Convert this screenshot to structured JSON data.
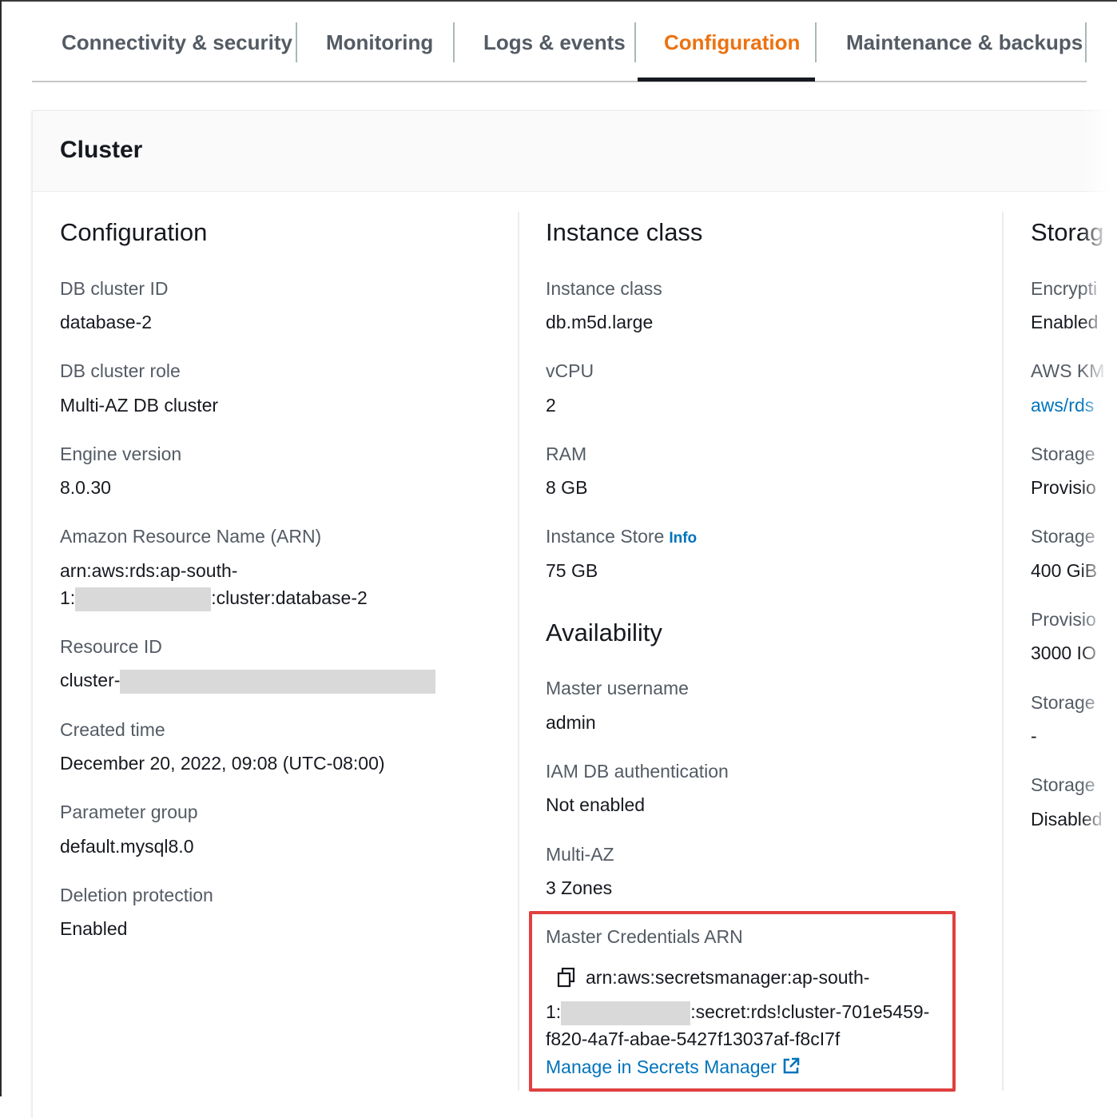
{
  "tabs": {
    "items": [
      {
        "label": "Connectivity & security",
        "active": false
      },
      {
        "label": "Monitoring",
        "active": false
      },
      {
        "label": "Logs & events",
        "active": false
      },
      {
        "label": "Configuration",
        "active": true
      },
      {
        "label": "Maintenance & backups",
        "active": false
      }
    ]
  },
  "panel": {
    "title": "Cluster"
  },
  "configuration": {
    "title": "Configuration",
    "db_cluster_id": {
      "label": "DB cluster ID",
      "value": "database-2"
    },
    "db_cluster_role": {
      "label": "DB cluster role",
      "value": "Multi-AZ DB cluster"
    },
    "engine_version": {
      "label": "Engine version",
      "value": "8.0.30"
    },
    "arn": {
      "label": "Amazon Resource Name (ARN)",
      "line1": "arn:aws:rds:ap-south-",
      "line2_prefix": "1:",
      "line2_suffix": ":cluster:database-2"
    },
    "resource_id": {
      "label": "Resource ID",
      "value_prefix": "cluster-"
    },
    "created_time": {
      "label": "Created time",
      "value": "December 20, 2022, 09:08 (UTC-08:00)"
    },
    "parameter_group": {
      "label": "Parameter group",
      "value": "default.mysql8.0"
    },
    "deletion_protection": {
      "label": "Deletion protection",
      "value": "Enabled"
    }
  },
  "instance_class": {
    "title": "Instance class",
    "instance_class": {
      "label": "Instance class",
      "value": "db.m5d.large"
    },
    "vcpu": {
      "label": "vCPU",
      "value": "2"
    },
    "ram": {
      "label": "RAM",
      "value": "8 GB"
    },
    "instance_store": {
      "label": "Instance Store",
      "info": "Info",
      "value": "75 GB"
    }
  },
  "availability": {
    "title": "Availability",
    "master_username": {
      "label": "Master username",
      "value": "admin"
    },
    "iam_db_auth": {
      "label": "IAM DB authentication",
      "value": "Not enabled"
    },
    "multi_az": {
      "label": "Multi-AZ",
      "value": "3 Zones"
    },
    "master_credentials": {
      "label": "Master Credentials ARN",
      "line1": "arn:aws:secretsmanager:ap-south-",
      "line2_prefix": "1:",
      "line2_suffix": ":secret:rds!cluster-701e5459-",
      "line3": "f820-4a7f-abae-5427f13037af-f8cI7f",
      "link": "Manage in Secrets Manager"
    }
  },
  "storage": {
    "title": "Storag",
    "rows": [
      {
        "label": "Encrypti",
        "value": "Enabled"
      },
      {
        "label": "AWS KM",
        "value": "aws/rds",
        "is_link": true
      },
      {
        "label": "Storage",
        "value": "Provisio"
      },
      {
        "label": "Storage",
        "value": "400 GiB"
      },
      {
        "label": "Provisio",
        "value": "3000 IO"
      },
      {
        "label": "Storage",
        "value": "-"
      },
      {
        "label": "Storage",
        "value": "Disabled"
      }
    ]
  },
  "colors": {
    "accent": "#ec7211",
    "link": "#0073bb",
    "highlight": "#e0403f"
  },
  "icons": {
    "copy": "copy-icon",
    "external": "external-link-icon"
  }
}
